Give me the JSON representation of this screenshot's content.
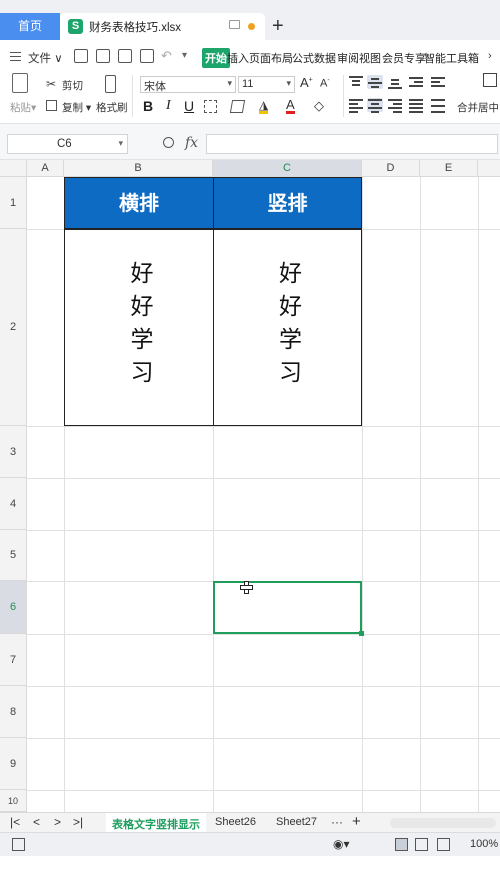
{
  "tabs": {
    "home": "首页",
    "file_name": "财务表格技巧.xlsx",
    "new_tab": "+"
  },
  "menu": {
    "file": "文件",
    "items": [
      "开始",
      "插入",
      "页面布局",
      "公式",
      "数据",
      "审阅",
      "视图",
      "会员专享",
      "智能工具箱"
    ],
    "active": "开始"
  },
  "ribbon": {
    "paste": "粘贴",
    "cut": "剪切",
    "copy": "复制",
    "format_painter": "格式刷",
    "font_name": "宋体",
    "font_size": "11",
    "bold": "B",
    "italic": "I",
    "underline": "U",
    "merge_center": "合并居中"
  },
  "formula_bar": {
    "cell_ref": "C6",
    "fx": "fx",
    "formula": ""
  },
  "grid": {
    "columns": [
      "A",
      "B",
      "C",
      "D",
      "E"
    ],
    "selected_column": "C",
    "rows": [
      "1",
      "2",
      "3",
      "4",
      "5",
      "6",
      "7",
      "8",
      "9",
      "10"
    ],
    "selected_row": "6",
    "cells": {
      "B1": "横排",
      "C1": "竖排",
      "B2": "好好学习",
      "C2": "好好学习"
    },
    "active_cell": "C6",
    "header_fill_color": "#0e6bc4",
    "active_border_color": "#1e9e5a"
  },
  "sheet_tabs": {
    "items": [
      "表格文字竖排显示",
      "Sheet26",
      "Sheet27"
    ],
    "active": "表格文字竖排显示",
    "more": "···",
    "add": "+"
  },
  "status_bar": {
    "zoom": "100%"
  }
}
